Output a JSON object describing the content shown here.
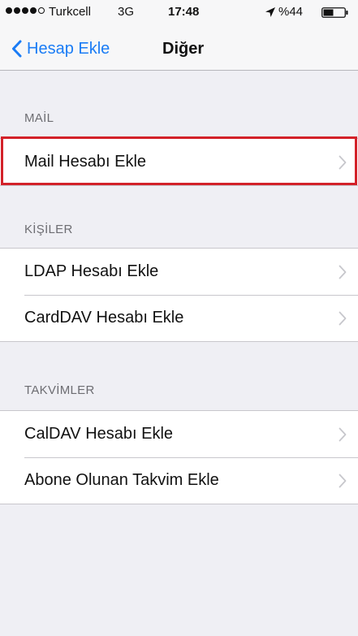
{
  "status_bar": {
    "signal_dots": [
      true,
      true,
      true,
      true,
      false
    ],
    "carrier": "Turkcell",
    "network": "3G",
    "time": "17:48",
    "battery_percent": "%44",
    "location_icon": "location-arrow-icon",
    "battery_icon": "battery-icon"
  },
  "nav": {
    "back_label": "Hesap Ekle",
    "back_icon": "chevron-left-icon",
    "title": "Diğer"
  },
  "sections": [
    {
      "header": "MAİL",
      "items": [
        {
          "label": "Mail Hesabı Ekle"
        }
      ]
    },
    {
      "header": "KİŞİLER",
      "items": [
        {
          "label": "LDAP Hesabı Ekle"
        },
        {
          "label": "CardDAV Hesabı Ekle"
        }
      ]
    },
    {
      "header": "TAKVİMLER",
      "items": [
        {
          "label": "CalDAV Hesabı Ekle"
        },
        {
          "label": "Abone Olunan Takvim Ekle"
        }
      ]
    }
  ],
  "colors": {
    "accent": "#1a7cf5",
    "highlight": "#d32129",
    "background": "#efeff4"
  }
}
